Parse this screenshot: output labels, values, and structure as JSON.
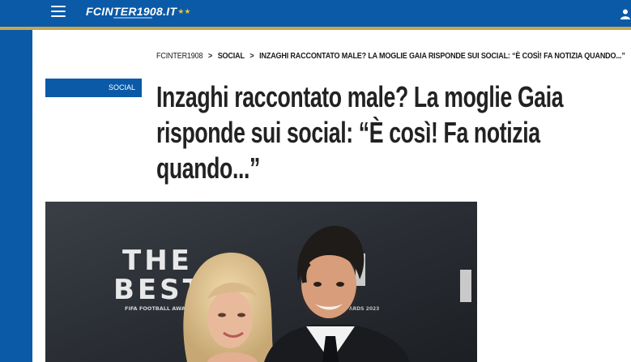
{
  "header": {
    "logo_text": "FCINTER1908.IT",
    "logo_stars": "★★",
    "menu_icon": "hamburger-menu-icon",
    "user_icon": "user-icon",
    "brand_color": "#0a5aa8",
    "accent_color": "#c9a64b"
  },
  "breadcrumb": {
    "home": "FCINTER1908",
    "separator": ">",
    "section": "SOCIAL",
    "current": "INZAGHI RACCONTATO MALE? LA MOGLIE GAIA RISPONDE SUI SOCIAL: “È COSÌ! FA NOTIZIA QUANDO...”"
  },
  "article": {
    "category": "SOCIAL",
    "title_line1": "Inzaghi raccontato male? La moglie Gaia",
    "title_line2": "risponde sui social: “È così! Fa notizia",
    "title_line3": "quando...”"
  },
  "hero_image": {
    "backdrop_text_1": "THE",
    "backdrop_text_2": "BEST",
    "backdrop_caption": "FIFA FOOTBALL AWARDS",
    "backdrop_caption_2": "ARDS 2023"
  }
}
